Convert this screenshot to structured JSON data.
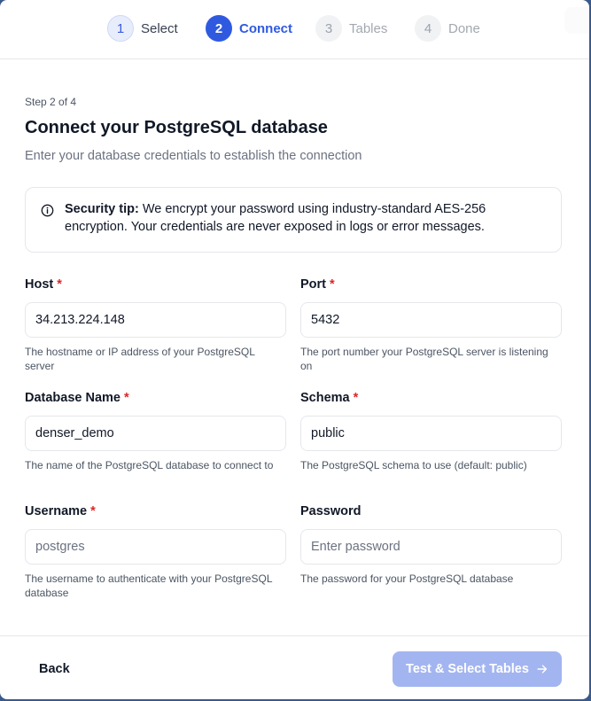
{
  "stepper": {
    "steps": [
      {
        "number": "1",
        "label": "Select",
        "state": "done"
      },
      {
        "number": "2",
        "label": "Connect",
        "state": "active"
      },
      {
        "number": "3",
        "label": "Tables",
        "state": "future"
      },
      {
        "number": "4",
        "label": "Done",
        "state": "future"
      }
    ]
  },
  "header": {
    "step_count": "Step 2 of 4",
    "title": "Connect your PostgreSQL database",
    "subtitle": "Enter your database credentials to establish the connection"
  },
  "tip": {
    "icon": "info-icon",
    "label": "Security tip:",
    "text": "We encrypt your password using industry-standard AES-256 encryption. Your credentials are never exposed in logs or error messages."
  },
  "fields": {
    "host": {
      "label": "Host",
      "required": "*",
      "value": "34.213.224.148",
      "help": "The hostname or IP address of your PostgreSQL server"
    },
    "port": {
      "label": "Port",
      "required": "*",
      "value": "5432",
      "help": "The port number your PostgreSQL server is listening on"
    },
    "database": {
      "label": "Database Name",
      "required": "*",
      "value": "denser_demo",
      "help": "The name of the PostgreSQL database to connect to"
    },
    "schema": {
      "label": "Schema",
      "required": "*",
      "value": "public",
      "help": "The PostgreSQL schema to use (default: public)"
    },
    "username": {
      "label": "Username",
      "required": "*",
      "value": "",
      "placeholder": "postgres",
      "help": "The username to authenticate with your PostgreSQL database"
    },
    "password": {
      "label": "Password",
      "value": "",
      "placeholder": "Enter password",
      "help": "The password for your PostgreSQL database"
    }
  },
  "footer": {
    "back_label": "Back",
    "next_label": "Test & Select Tables",
    "next_icon": "arrow-right-icon"
  },
  "colors": {
    "accent": "#2f5ae0",
    "accent_disabled": "#a3b5f0",
    "required": "#dc2626"
  }
}
